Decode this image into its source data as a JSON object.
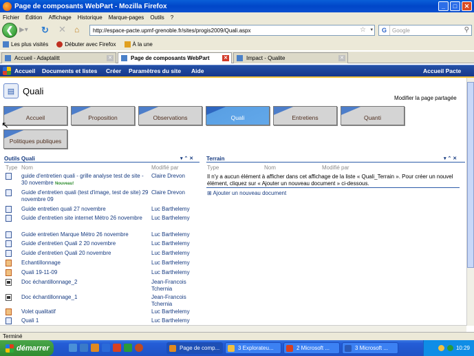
{
  "window": {
    "title": "Page de composants WebPart - Mozilla Firefox",
    "minimize": "_",
    "maximize": "□",
    "close": "✕"
  },
  "menubar": [
    "Fichier",
    "Édition",
    "Affichage",
    "Historique",
    "Marque-pages",
    "Outils",
    "?"
  ],
  "navbar": {
    "url": "http://espace-pacte.upmf-grenoble.fr/sites/progis2009/Quali.aspx",
    "search_placeholder": "Google"
  },
  "bookmarks": [
    "Les plus visités",
    "Débuter avec Firefox",
    "À la une"
  ],
  "tabs": [
    {
      "label": "Accueil - Adaptalitt",
      "active": false
    },
    {
      "label": "Page de composants WebPart",
      "active": true
    },
    {
      "label": "Impact - Qualite",
      "active": false
    }
  ],
  "sharepoint": {
    "top_links": [
      "Accueil",
      "Documents et listes",
      "Créer",
      "Paramètres du site",
      "Aide"
    ],
    "right_link": "Accueil Pacte",
    "site_title": "Quali",
    "modify_page": "Modifier la page partagée",
    "nav_tiles": [
      "Accueil",
      "Proposition",
      "Observations",
      "Quali",
      "Entretiens",
      "Quanti",
      "Politiques publiques"
    ],
    "selected_tile": "Quali"
  },
  "outils": {
    "title": "Outils Quali",
    "controls": "▾ ⌃ ✕",
    "headers": [
      "Type",
      "Nom",
      "Modifié par"
    ],
    "new_tag": "Nouveau!",
    "rows": [
      {
        "icon": "doc",
        "name": "guide d'entretien quali - grille analyse test de site - 30 novembre",
        "modified_by": "Claire Drevon",
        "new": true
      },
      {
        "icon": "doc",
        "name": "Guide d'entretien quali (test d'image, test de site) 29 novembre 09",
        "modified_by": "Claire Drevon",
        "new": false
      },
      {
        "icon": "doc",
        "name": "Guide entretien quali 27 novembre",
        "modified_by": "Luc Barthelemy",
        "new": false
      },
      {
        "icon": "doc",
        "name": "Guide d'entretien site internet Métro 26 novembre",
        "modified_by": "Luc Barthelemy",
        "new": false
      },
      {
        "icon": "doc",
        "name": "Guide entretien Marque Métro 26 novembre",
        "modified_by": "Luc Barthelemy",
        "new": false
      },
      {
        "icon": "doc",
        "name": "Guide d'entretien Quali 2 20 novembre",
        "modified_by": "Luc Barthelemy",
        "new": false
      },
      {
        "icon": "doc",
        "name": "Guide d'entretien Quali 20 novembre",
        "modified_by": "Luc Barthelemy",
        "new": false
      },
      {
        "icon": "ppt",
        "name": "Echantillonnage",
        "modified_by": "Luc Barthelemy",
        "new": false
      },
      {
        "icon": "ppt",
        "name": "Quali 19-11-09",
        "modified_by": "Luc Barthelemy",
        "new": false
      },
      {
        "icon": "img",
        "name": "Doc échantillonnage_2",
        "modified_by": "Jean-Francois Tchernia",
        "new": false
      },
      {
        "icon": "img",
        "name": "Doc échantillonnage_1",
        "modified_by": "Jean-Francois Tchernia",
        "new": false
      },
      {
        "icon": "ppt",
        "name": "Volet qualitatif",
        "modified_by": "Luc Barthelemy",
        "new": false
      },
      {
        "icon": "doc",
        "name": "Quali 1",
        "modified_by": "Luc Barthelemy",
        "new": false
      }
    ]
  },
  "terrain": {
    "title": "Terrain",
    "controls": "▾ ⌃ ✕",
    "headers": [
      "Type",
      "Nom",
      "Modifié par"
    ],
    "message": "Il n'y a aucun élément à afficher dans cet affichage de la liste « Quali_Terrain ». Pour créer un nouvel élément, cliquez sur « Ajouter un nouveau document » ci-dessous.",
    "add_link": "Ajouter un nouveau document"
  },
  "status": "Terminé",
  "taskbar": {
    "start": "démarrer",
    "tasks": [
      {
        "label": "Page de comp...",
        "active": true
      },
      {
        "label": "3 Explorateu...",
        "active": false
      },
      {
        "label": "2 Microsoft ...",
        "active": false
      },
      {
        "label": "3 Microsoft ...",
        "active": false
      }
    ],
    "clock": "10:29"
  }
}
